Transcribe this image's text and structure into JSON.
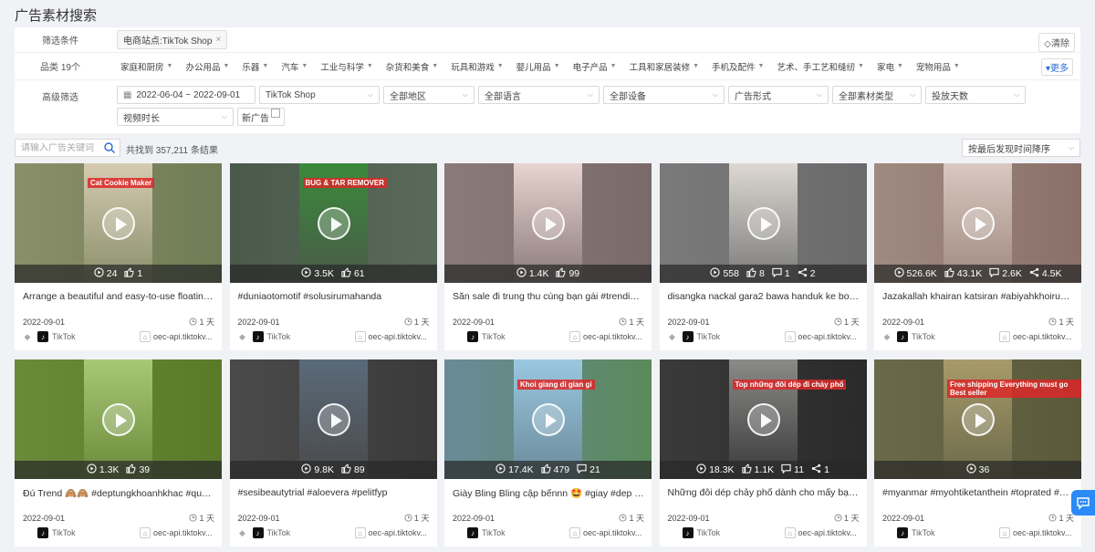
{
  "page": {
    "title": "广告素材搜索"
  },
  "filters": {
    "row1": {
      "label": "筛选条件",
      "tag": "电商站点:TikTok Shop",
      "tag_close": "×",
      "clear": "◇清除"
    },
    "row2": {
      "label": "品类 19个",
      "categories": [
        "家庭和厨房",
        "办公用品",
        "乐器",
        "汽车",
        "工业与科学",
        "杂货和美食",
        "玩具和游戏",
        "婴儿用品",
        "电子产品",
        "工具和家居装修",
        "手机及配件",
        "艺术、手工艺和缝纫",
        "家电",
        "宠物用品"
      ],
      "more": "更多"
    },
    "row3": {
      "label": "高级筛选",
      "date_range": "2022-06-04 ~ 2022-09-01",
      "selects": [
        "TikTok Shop",
        "全部地区",
        "全部语言",
        "全部设备",
        "广告形式",
        "全部素材类型",
        "投放天数",
        "视频时长"
      ],
      "new_ad": "新广告"
    }
  },
  "search": {
    "placeholder": "请输入广告关键词",
    "result_text": "共找到 357,211 条结果",
    "sort": "按最后发现时间降序"
  },
  "colors": {
    "accent": "#2a6ad9",
    "chat": "#2a8af7"
  },
  "cards": [
    {
      "caption": "Arrange a beautiful and easy-to-use floating ...",
      "date": "2022-09-01",
      "days": "1 天",
      "platform": "TikTok",
      "domain": "oec-api.tiktokv...",
      "os": "android",
      "overlay": "Cat Cookie Maker",
      "stats": [
        {
          "icon": "views",
          "value": "24"
        },
        {
          "icon": "likes",
          "value": "1"
        }
      ],
      "colors": [
        "#8a8f6a",
        "#d6cbb2",
        "#6f7c55"
      ]
    },
    {
      "caption": "#duniaotomotif #solusirumahanda",
      "date": "2022-09-01",
      "days": "1 天",
      "platform": "TikTok",
      "domain": "oec-api.tiktokv...",
      "os": "android",
      "overlay": "BUG & TAR REMOVER",
      "stats": [
        {
          "icon": "views",
          "value": "3.5K"
        },
        {
          "icon": "likes",
          "value": "61"
        }
      ],
      "colors": [
        "#4a5a4a",
        "#3a8a3a",
        "#5a6a5a"
      ]
    },
    {
      "caption": "Săn sale đi trung thu cùng bạn gái #trending ...",
      "date": "2022-09-01",
      "days": "1 天",
      "platform": "TikTok",
      "domain": "oec-api.tiktokv...",
      "os": "apple",
      "overlay": "",
      "stats": [
        {
          "icon": "views",
          "value": "1.4K"
        },
        {
          "icon": "likes",
          "value": "99"
        }
      ],
      "colors": [
        "#8a7a7a",
        "#e8d4d0",
        "#7a6a6a"
      ]
    },
    {
      "caption": "disangka nackal gara2 bawa handuk ke botel...",
      "date": "2022-09-01",
      "days": "1 天",
      "platform": "TikTok",
      "domain": "oec-api.tiktokv...",
      "os": "android",
      "overlay": "",
      "stats": [
        {
          "icon": "views",
          "value": "558"
        },
        {
          "icon": "likes",
          "value": "8"
        },
        {
          "icon": "comments",
          "value": "1"
        },
        {
          "icon": "shares",
          "value": "2"
        }
      ],
      "colors": [
        "#7a7a7a",
        "#ddd8d2",
        "#6a6a6a"
      ]
    },
    {
      "caption": "Jazakallah khairan katsiran #abiyahkhoirunisa",
      "date": "2022-09-01",
      "days": "1 天",
      "platform": "TikTok",
      "domain": "oec-api.tiktokv...",
      "os": "android",
      "overlay": "",
      "stats": [
        {
          "icon": "views",
          "value": "526.6K"
        },
        {
          "icon": "likes",
          "value": "43.1K"
        },
        {
          "icon": "comments",
          "value": "2.6K"
        },
        {
          "icon": "shares",
          "value": "4.5K"
        }
      ],
      "colors": [
        "#a08a80",
        "#d8c8c0",
        "#8a7068"
      ]
    },
    {
      "caption": "Đú Trend 🙈🙈 #deptungkhoanhkhac #quoc...",
      "date": "2022-09-01",
      "days": "1 天",
      "platform": "TikTok",
      "domain": "oec-api.tiktokv...",
      "os": "apple",
      "overlay": "",
      "stats": [
        {
          "icon": "views",
          "value": "1.3K"
        },
        {
          "icon": "likes",
          "value": "39"
        }
      ],
      "colors": [
        "#6a8a3a",
        "#a8c878",
        "#5a7a2a"
      ]
    },
    {
      "caption": "#sesibeautytrial #aloevera #pelitfyp",
      "date": "2022-09-01",
      "days": "1 天",
      "platform": "TikTok",
      "domain": "oec-api.tiktokv...",
      "os": "android",
      "overlay": "",
      "stats": [
        {
          "icon": "views",
          "value": "9.8K"
        },
        {
          "icon": "likes",
          "value": "89"
        }
      ],
      "colors": [
        "#4a4a4a",
        "#5a6a7a",
        "#3a3a3a"
      ]
    },
    {
      "caption": "Giày Bling Bling cập bếnnn 🤩 #giay #dep #...",
      "date": "2022-09-01",
      "days": "1 天",
      "platform": "TikTok",
      "domain": "oec-api.tiktokv...",
      "os": "apple",
      "overlay": "Khoi giang di gian gi",
      "stats": [
        {
          "icon": "views",
          "value": "17.4K"
        },
        {
          "icon": "likes",
          "value": "479"
        },
        {
          "icon": "comments",
          "value": "21"
        }
      ],
      "colors": [
        "#6a8a9a",
        "#9ac8e0",
        "#5a8a5a"
      ]
    },
    {
      "caption": "Những đôi dép chảy phố dành cho mấy bạn ...",
      "date": "2022-09-01",
      "days": "1 天",
      "platform": "TikTok",
      "domain": "oec-api.tiktokv...",
      "os": "apple",
      "overlay": "Top những đôi dép đi chảy phố",
      "stats": [
        {
          "icon": "views",
          "value": "18.3K"
        },
        {
          "icon": "likes",
          "value": "1.1K"
        },
        {
          "icon": "comments",
          "value": "11"
        },
        {
          "icon": "shares",
          "value": "1"
        }
      ],
      "colors": [
        "#3a3a3a",
        "#8a8a88",
        "#2a2a2a"
      ]
    },
    {
      "caption": "#myanmar #myohtiketanthein #toprated #be...",
      "date": "2022-09-01",
      "days": "1 天",
      "platform": "TikTok",
      "domain": "oec-api.tiktokv...",
      "os": "apple",
      "overlay": "Free shipping Everything must go Best seller",
      "stats": [
        {
          "icon": "views",
          "value": "36"
        }
      ],
      "colors": [
        "#6a6a4a",
        "#a89a6a",
        "#5a5a3a"
      ]
    }
  ]
}
